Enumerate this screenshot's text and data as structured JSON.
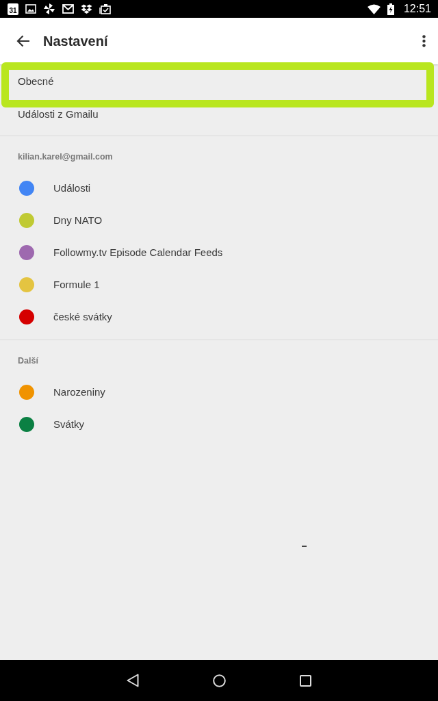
{
  "status_bar": {
    "calendar_day": "31",
    "time": "12:51"
  },
  "toolbar": {
    "title": "Nastavení"
  },
  "general_items": [
    {
      "label": "Obecné",
      "highlighted": true
    },
    {
      "label": "Události z Gmailu",
      "highlighted": false
    }
  ],
  "sections": [
    {
      "header": "kilian.karel@gmail.com",
      "calendars": [
        {
          "name": "Události",
          "color": "#4285f4"
        },
        {
          "name": "Dny NATO",
          "color": "#c0ca33"
        },
        {
          "name": "Followmy.tv Episode Calendar Feeds",
          "color": "#9e69af"
        },
        {
          "name": "Formule 1",
          "color": "#e4c441"
        },
        {
          "name": "české svátky",
          "color": "#d50000"
        }
      ]
    },
    {
      "header": "Další",
      "calendars": [
        {
          "name": "Narozeniny",
          "color": "#f09300"
        },
        {
          "name": "Svátky",
          "color": "#0b8043"
        }
      ]
    }
  ]
}
